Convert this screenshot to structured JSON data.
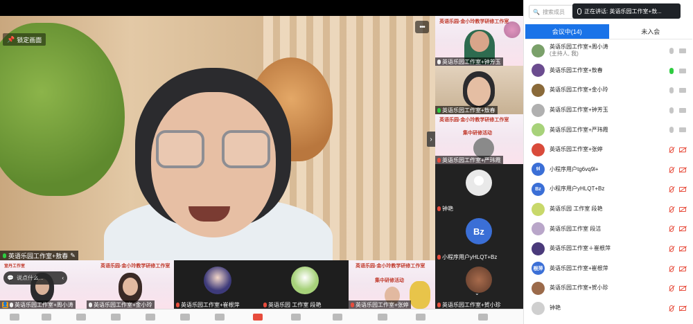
{
  "main_video": {
    "lock_label": "锁定画面",
    "more_label": "•••",
    "speaker_name": "英语乐园工作室+敖春"
  },
  "side_tiles": [
    {
      "name": "英语乐园工作室+钟芳玉",
      "kind": "poster",
      "poster_title": "英语乐园-金小玲教学研修工作室",
      "mic": "normal"
    },
    {
      "name": "英语乐园工作室+敖春",
      "kind": "video",
      "mic": "green"
    },
    {
      "name": "英语乐园工作室+严玮霞",
      "kind": "poster",
      "poster_title": "英语乐园-金小玲教学研修工作室",
      "poster_sub": "集中研修活动",
      "mic": "muted"
    },
    {
      "name": "钟艳",
      "kind": "avatar",
      "avatar_text": "",
      "mic": "muted"
    },
    {
      "name": "小程序用户yHLQT+Bz",
      "kind": "avatar",
      "avatar_text": "Bz",
      "mic": "muted"
    },
    {
      "name": "英语乐园工作室+贺小珍",
      "kind": "video",
      "mic": "muted"
    }
  ],
  "bottom_tiles": [
    {
      "name": "英语乐园工作室+周小涛",
      "kind": "poster",
      "poster_title": "宣丹工作室",
      "mic": "normal",
      "host": true
    },
    {
      "name": "英语乐园工作室+金小玲",
      "kind": "poster",
      "poster_title": "英语乐园-金小玲教学研修工作室",
      "mic": "normal"
    },
    {
      "name": "英语乐园工作室+崔根萍",
      "kind": "avatar",
      "mic": "muted"
    },
    {
      "name": "英语乐园 工作室 段艳",
      "kind": "avatar",
      "mic": "muted"
    },
    {
      "name": "英语乐园工作室+张婷",
      "kind": "poster",
      "poster_title": "英语乐园-金小玲教学研修工作室",
      "poster_sub": "集中研修活动",
      "mic": "muted"
    }
  ],
  "chat": {
    "placeholder": "说点什么...",
    "arrow": "‹"
  },
  "panel": {
    "search_placeholder": "搜索成员",
    "speaking_label": "正在讲话: 英语乐园工作室+敖...",
    "tab_in_meeting": "会议中(14)",
    "tab_not_joined": "未入会",
    "participants": [
      {
        "name": "英语乐园工作室+周小涛",
        "role": "(主持人, 我)",
        "avatar": "",
        "av_color": "#7aa06a",
        "mic": "idle",
        "cam": "on"
      },
      {
        "name": "英语乐园工作室+敖春",
        "role": "",
        "avatar": "",
        "av_color": "#6b4c8f",
        "mic": "on",
        "cam": "on"
      },
      {
        "name": "英语乐园工作室+金小玲",
        "role": "",
        "avatar": "",
        "av_color": "#8a6a3a",
        "mic": "idle",
        "cam": "on"
      },
      {
        "name": "英语乐园工作室+钟芳玉",
        "role": "",
        "avatar": "",
        "av_color": "#b0b0b0",
        "mic": "idle",
        "cam": "on"
      },
      {
        "name": "英语乐园工作室+严玮霞",
        "role": "",
        "avatar": "",
        "av_color": "#a7d27a",
        "mic": "idle",
        "cam": "on"
      },
      {
        "name": "英语乐园工作室+张婷",
        "role": "",
        "avatar": "",
        "av_color": "#d94b3b",
        "mic": "off",
        "cam": "off"
      },
      {
        "name": "小程序用户tg6vq9l+",
        "role": "",
        "avatar": "9l",
        "av_color": "#3b6fd6",
        "mic": "off",
        "cam": "off"
      },
      {
        "name": "小程序用户yHLQT+Bz",
        "role": "",
        "avatar": "Bz",
        "av_color": "#3b6fd6",
        "mic": "off",
        "cam": "off"
      },
      {
        "name": "英语乐园 工作室 段艳",
        "role": "",
        "avatar": "",
        "av_color": "#c8d86a",
        "mic": "off",
        "cam": "off"
      },
      {
        "name": "英语乐园工作室 段洁",
        "role": "",
        "avatar": "",
        "av_color": "#b9a6c9",
        "mic": "off",
        "cam": "off"
      },
      {
        "name": "英语乐园工作室＋崔根萍",
        "role": "",
        "avatar": "",
        "av_color": "#4a3a7a",
        "mic": "off",
        "cam": "off"
      },
      {
        "name": "英语乐园工作室+崔根萍",
        "role": "",
        "avatar": "根萍",
        "av_color": "#3b6fd6",
        "mic": "off",
        "cam": "off"
      },
      {
        "name": "英语乐园工作室+贺小珍",
        "role": "",
        "avatar": "",
        "av_color": "#9b6a4a",
        "mic": "off",
        "cam": "off"
      },
      {
        "name": "钟艳",
        "role": "",
        "avatar": "",
        "av_color": "#cfcfcf",
        "mic": "off",
        "cam": "off"
      }
    ]
  },
  "colors": {
    "accent": "#1a73e8",
    "speaking_green": "#2ecc40",
    "muted_red": "#e74c3c"
  }
}
